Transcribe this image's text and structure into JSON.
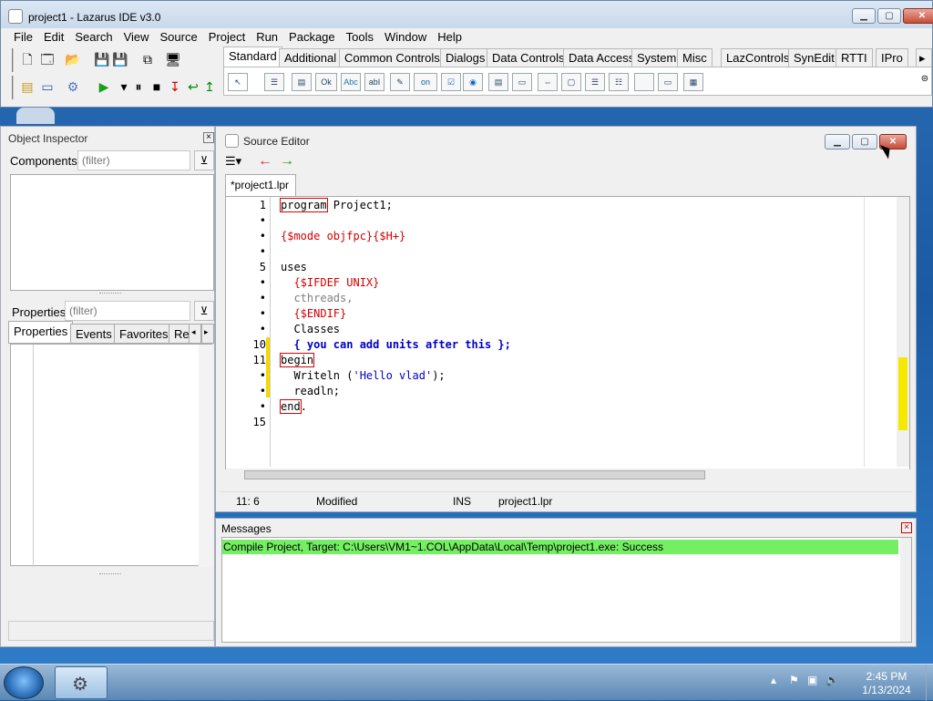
{
  "window": {
    "title": "project1 - Lazarus IDE v3.0"
  },
  "menu": [
    "File",
    "Edit",
    "Search",
    "View",
    "Source",
    "Project",
    "Run",
    "Package",
    "Tools",
    "Window",
    "Help"
  ],
  "palette_tabs": [
    "Standard",
    "Additional",
    "Common Controls",
    "Dialogs",
    "Data Controls",
    "Data Access",
    "System",
    "Misc",
    "LazControls",
    "SynEdit",
    "RTTI",
    "IPro"
  ],
  "palette_icons": [
    "Ok",
    "Abc",
    "abI",
    "on"
  ],
  "object_inspector": {
    "title": "Object Inspector",
    "components_label": "Components",
    "components_placeholder": "(filter)",
    "properties_label": "Properties",
    "properties_placeholder": "(filter)",
    "tabs": [
      "Properties",
      "Events",
      "Favorites",
      "Re"
    ]
  },
  "source_editor": {
    "title": "Source Editor",
    "tab": "*project1.lpr",
    "gutter": [
      "1",
      "•",
      "•",
      "•",
      "5",
      "•",
      "•",
      "•",
      "•",
      "10",
      "11",
      "•",
      "•",
      "•",
      "15"
    ],
    "lines": [
      {
        "parts": [
          {
            "t": "program",
            "c": "kw boxed"
          },
          {
            "t": " Project1;",
            "c": "kw"
          }
        ]
      },
      {
        "parts": []
      },
      {
        "parts": [
          {
            "t": "{$mode objfpc}{$H+}",
            "c": "dir"
          }
        ]
      },
      {
        "parts": []
      },
      {
        "parts": [
          {
            "t": "uses",
            "c": "kw"
          }
        ]
      },
      {
        "parts": [
          {
            "t": "  {$IFDEF UNIX}",
            "c": "dir"
          }
        ]
      },
      {
        "parts": [
          {
            "t": "  cthreads,",
            "c": "grey"
          }
        ]
      },
      {
        "parts": [
          {
            "t": "  {$ENDIF}",
            "c": "dir"
          }
        ]
      },
      {
        "parts": [
          {
            "t": "  Classes",
            "c": "kw"
          }
        ]
      },
      {
        "parts": [
          {
            "t": "  { you can add units after this };",
            "c": "cmt"
          }
        ]
      },
      {
        "parts": [
          {
            "t": "begin",
            "c": "kw boxed"
          }
        ]
      },
      {
        "parts": [
          {
            "t": "  Writeln (",
            "c": "kw"
          },
          {
            "t": "'Hello vlad'",
            "c": "str"
          },
          {
            "t": ");",
            "c": "kw"
          }
        ]
      },
      {
        "parts": [
          {
            "t": "  readln;",
            "c": "kw"
          }
        ]
      },
      {
        "parts": [
          {
            "t": "end",
            "c": "kw boxed"
          },
          {
            "t": ".",
            "c": "kw"
          }
        ]
      },
      {
        "parts": []
      }
    ],
    "status": {
      "pos": "11: 6",
      "state": "Modified",
      "mode": "INS",
      "file": "project1.lpr"
    }
  },
  "messages": {
    "title": "Messages",
    "line": "Compile Project, Target: C:\\Users\\VM1~1.COL\\AppData\\Local\\Temp\\project1.exe: Success",
    "success_color": "#74ee63"
  },
  "taskbar": {
    "time": "2:45 PM",
    "date": "1/13/2024"
  }
}
